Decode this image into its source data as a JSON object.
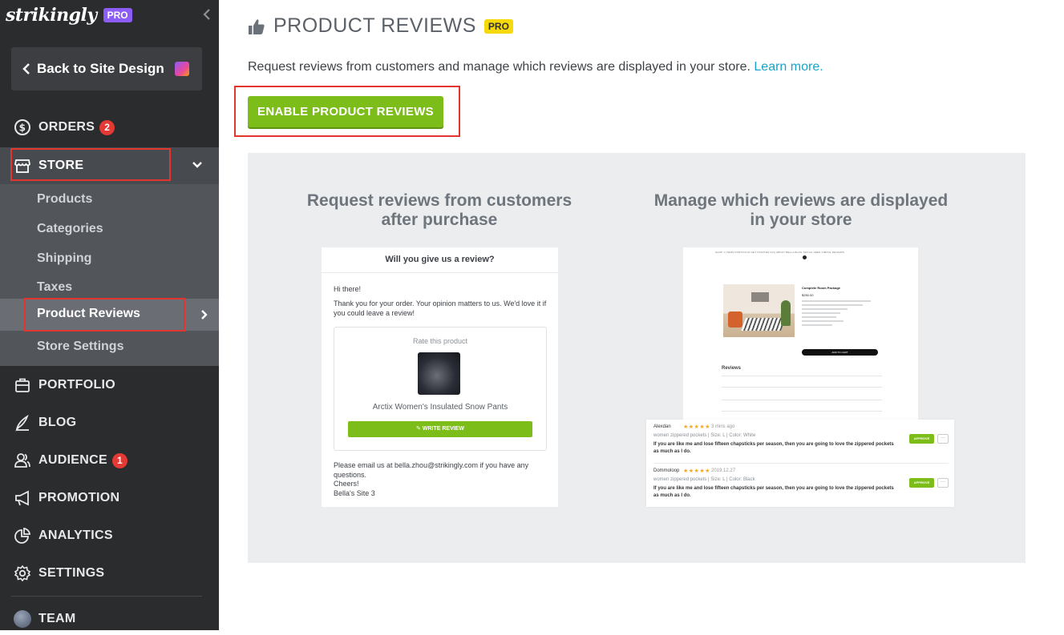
{
  "sidebar": {
    "brand": "strikingly",
    "brand_badge": "PRO",
    "back_label": "Back to Site Design",
    "nav": {
      "orders": {
        "label": "ORDERS",
        "badge": "2"
      },
      "store": {
        "label": "STORE"
      },
      "portfolio": {
        "label": "PORTFOLIO"
      },
      "blog": {
        "label": "BLOG"
      },
      "audience": {
        "label": "AUDIENCE",
        "badge": "1"
      },
      "promotion": {
        "label": "PROMOTION"
      },
      "analytics": {
        "label": "ANALYTICS"
      },
      "settings": {
        "label": "SETTINGS"
      },
      "team": {
        "label": "TEAM"
      }
    },
    "store_items": {
      "products": "Products",
      "categories": "Categories",
      "shipping": "Shipping",
      "taxes": "Taxes",
      "product_reviews": "Product Reviews",
      "store_settings": "Store Settings"
    }
  },
  "main": {
    "title": "PRODUCT REVIEWS",
    "title_badge": "PRO",
    "description": "Request reviews from customers and manage which reviews are displayed in your store.",
    "learn_more": "Learn more.",
    "enable_button": "ENABLE PRODUCT REVIEWS",
    "panel": {
      "left_heading_1": "Request reviews from customers",
      "left_heading_2": "after purchase",
      "right_heading_1": "Manage which reviews are displayed",
      "right_heading_2": "in your store"
    },
    "email_preview": {
      "header": "Will you give us a review?",
      "greeting": "Hi there!",
      "body": "Thank you for your order. Your opinion matters to us. We'd love it if you could leave a review!",
      "rate_label": "Rate this product",
      "product_name": "Arctix Women's Insulated Snow Pants",
      "write_review": "WRITE REVIEW",
      "footer": "Please email us at bella.zhou@strikingly.com if you have any questions.",
      "signoff": "Cheers!",
      "site": "Bella's Site 3"
    },
    "store_preview": {
      "nav_text": "SHOP 1 ITEMS     PORTFOLIO     GET STARTED     FAQ     ABOUT BELLA     BLOG     SOCIAL FEED     SIMPLE REVIEWS",
      "product_title": "Complete Room Package",
      "price": "$250.00",
      "add_to_cart": "ADD TO CART",
      "reviews_label": "Reviews"
    },
    "reviews": [
      {
        "name": "Alexdan",
        "stars": "★★★★★",
        "time": "3 mins ago",
        "meta": "women zippered pockets  |  Size: L  |  Color: White",
        "text": "If you are like me and lose fifteen chapsticks per season, then you are going to love the zippered pockets as much as I do.",
        "approve": "APPROVE",
        "more": "···"
      },
      {
        "name": "Dommoloop",
        "stars": "★★★★★",
        "time": "2019.12.27",
        "meta": "women zippered pockets  |  Size: L  |  Color: Black",
        "text": "If you are like me and lose fifteen chapsticks per season, then you are going to love the zippered pockets as much as I do.",
        "approve": "APPROVE",
        "more": "···"
      }
    ]
  },
  "colors": {
    "sidebar_bg": "#2b2c2e",
    "accent_green": "#7cbd1a",
    "link_blue": "#18a3c9",
    "badge_red": "#e53935",
    "pro_purple": "#8b5cf6",
    "pro_yellow": "#f5d90a",
    "highlight_red": "#e2352f"
  }
}
